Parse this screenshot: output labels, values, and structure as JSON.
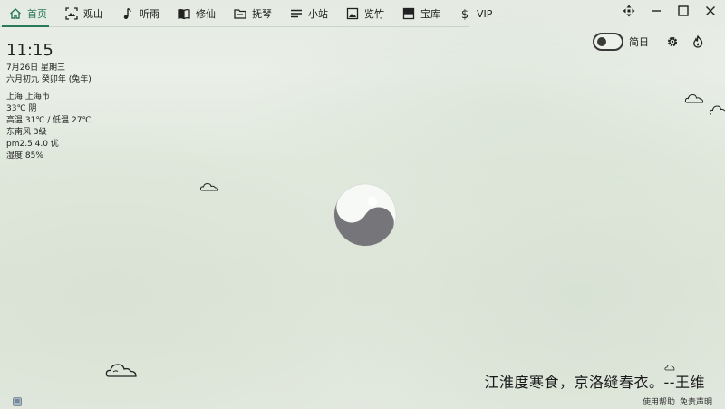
{
  "nav": {
    "items": [
      {
        "label": "首页",
        "icon": "home-icon"
      },
      {
        "label": "观山",
        "icon": "image-frame-icon"
      },
      {
        "label": "听雨",
        "icon": "music-note-icon"
      },
      {
        "label": "修仙",
        "icon": "book-icon"
      },
      {
        "label": "抚琴",
        "icon": "folder-icon"
      },
      {
        "label": "小站",
        "icon": "menu-lines-icon"
      },
      {
        "label": "览竹",
        "icon": "picture-icon"
      },
      {
        "label": "宝库",
        "icon": "storage-icon"
      },
      {
        "label": "VIP",
        "icon": "dollar-icon"
      }
    ],
    "active_color": "#2a7a57"
  },
  "window": {
    "controls": [
      "move-icon",
      "minimize-icon",
      "maximize-icon",
      "close-icon"
    ]
  },
  "toolbar": {
    "toggle_label": "简日",
    "toggle_on": false
  },
  "info": {
    "time": "11:15",
    "date": "7月26日  星期三",
    "lunar": "六月初九 癸卯年 (兔年)",
    "location": "上海 上海市",
    "weather": "33℃  阴",
    "temp_range": "高温 31℃ / 低温 27℃",
    "wind": "东南风 3级",
    "pm": "pm2.5 4.0 优",
    "humidity": "湿度 85%"
  },
  "poem": "江淮度寒食，京洛缝春衣。--王维",
  "footer": {
    "help": "使用帮助",
    "disclaimer": "免责声明"
  }
}
